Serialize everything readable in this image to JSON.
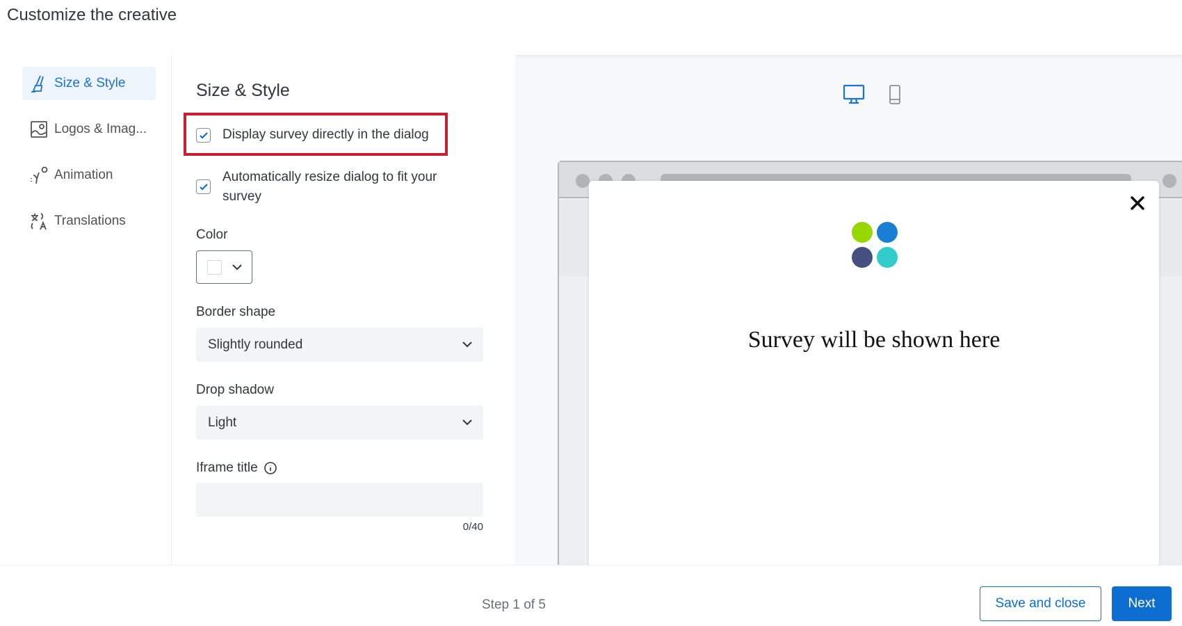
{
  "title": "Customize the creative",
  "sidebar": {
    "items": [
      {
        "label": "Size & Style",
        "icon": "brush-icon",
        "active": true
      },
      {
        "label": "Logos & Imag...",
        "icon": "image-icon"
      },
      {
        "label": "Animation",
        "icon": "animation-icon"
      },
      {
        "label": "Translations",
        "icon": "translate-icon"
      }
    ]
  },
  "panel": {
    "heading": "Size & Style",
    "display_survey": {
      "label": "Display survey directly in the dialog",
      "checked": true
    },
    "auto_resize": {
      "label_line1": "Automatically resize dialog to fit your",
      "label_line2": "survey",
      "checked": true
    },
    "color": {
      "label": "Color",
      "value": "#ffffff"
    },
    "border_shape": {
      "label": "Border shape",
      "value": "Slightly rounded"
    },
    "drop_shadow": {
      "label": "Drop shadow",
      "value": "Light"
    },
    "iframe_title": {
      "label": "Iframe title",
      "value": "",
      "counter": "0/40"
    }
  },
  "preview": {
    "selected_device": "desktop",
    "placeholder": "Survey will be shown here",
    "logo_colors": [
      "#97d700",
      "#1a7fd4",
      "#454f80",
      "#33cccc"
    ]
  },
  "footer": {
    "step": "Step 1 of 5",
    "save_label": "Save and close",
    "next_label": "Next"
  },
  "colors": {
    "accent": "#0b6ed0",
    "highlight": "#c8202f"
  }
}
